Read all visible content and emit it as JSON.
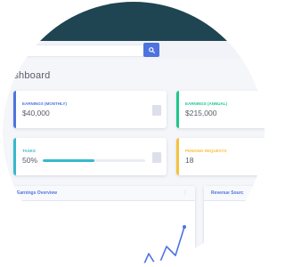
{
  "search": {
    "placeholder": "..."
  },
  "header": {
    "title": "ashboard"
  },
  "cards": [
    {
      "label": "EARNINGS (MONTHLY)",
      "value": "$40,000",
      "accent": "#4e73df",
      "label_color": "#4e73df",
      "icon": "calendar-icon"
    },
    {
      "label": "EARNINGS (ANNUAL)",
      "value": "$215,000",
      "accent": "#1cc88a",
      "label_color": "#1cc88a",
      "icon": "dollar-icon"
    },
    {
      "label": "TASKS",
      "value": "50%",
      "accent": "#36b9cc",
      "label_color": "#36b9cc",
      "icon": "clipboard-icon",
      "progress": 0.5
    },
    {
      "label": "PENDING REQUESTS",
      "value": "18",
      "accent": "#f6c23e",
      "label_color": "#f6c23e",
      "icon": "comments-icon"
    }
  ],
  "panels": {
    "earnings_title": "Earnings Overview",
    "revenue_title": "Revenue Sourc"
  },
  "colors": {
    "topbar": "#1f4553",
    "primary": "#4e73df",
    "success": "#1cc88a",
    "info": "#36b9cc",
    "warning": "#f6c23e"
  }
}
